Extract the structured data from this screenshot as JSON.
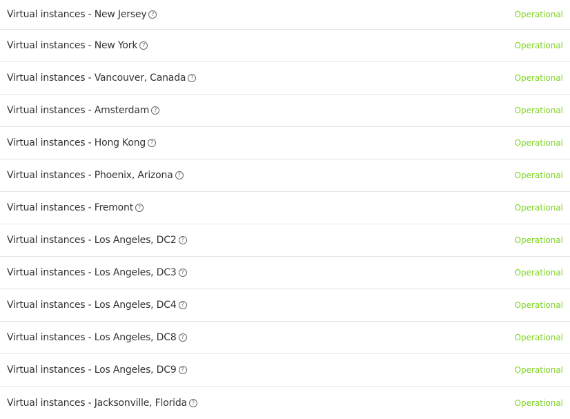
{
  "components": [
    {
      "name": "Virtual instances - New Jersey",
      "status": "Operational"
    },
    {
      "name": "Virtual instances - New York",
      "status": "Operational"
    },
    {
      "name": "Virtual instances - Vancouver, Canada",
      "status": "Operational"
    },
    {
      "name": "Virtual instances - Amsterdam",
      "status": "Operational"
    },
    {
      "name": "Virtual instances - Hong Kong",
      "status": "Operational"
    },
    {
      "name": "Virtual instances - Phoenix, Arizona",
      "status": "Operational"
    },
    {
      "name": "Virtual instances - Fremont",
      "status": "Operational"
    },
    {
      "name": "Virtual instances - Los Angeles, DC2",
      "status": "Operational"
    },
    {
      "name": "Virtual instances - Los Angeles, DC3",
      "status": "Operational"
    },
    {
      "name": "Virtual instances - Los Angeles, DC4",
      "status": "Operational"
    },
    {
      "name": "Virtual instances - Los Angeles, DC8",
      "status": "Operational"
    },
    {
      "name": "Virtual instances - Los Angeles, DC9",
      "status": "Operational"
    },
    {
      "name": "Virtual instances - Jacksonville, Florida",
      "status": "Operational"
    }
  ],
  "icons": {
    "help": "question-mark-circle-icon"
  },
  "colors": {
    "operational": "#7ed321",
    "text": "#333333",
    "divider": "#e4e4e4"
  }
}
